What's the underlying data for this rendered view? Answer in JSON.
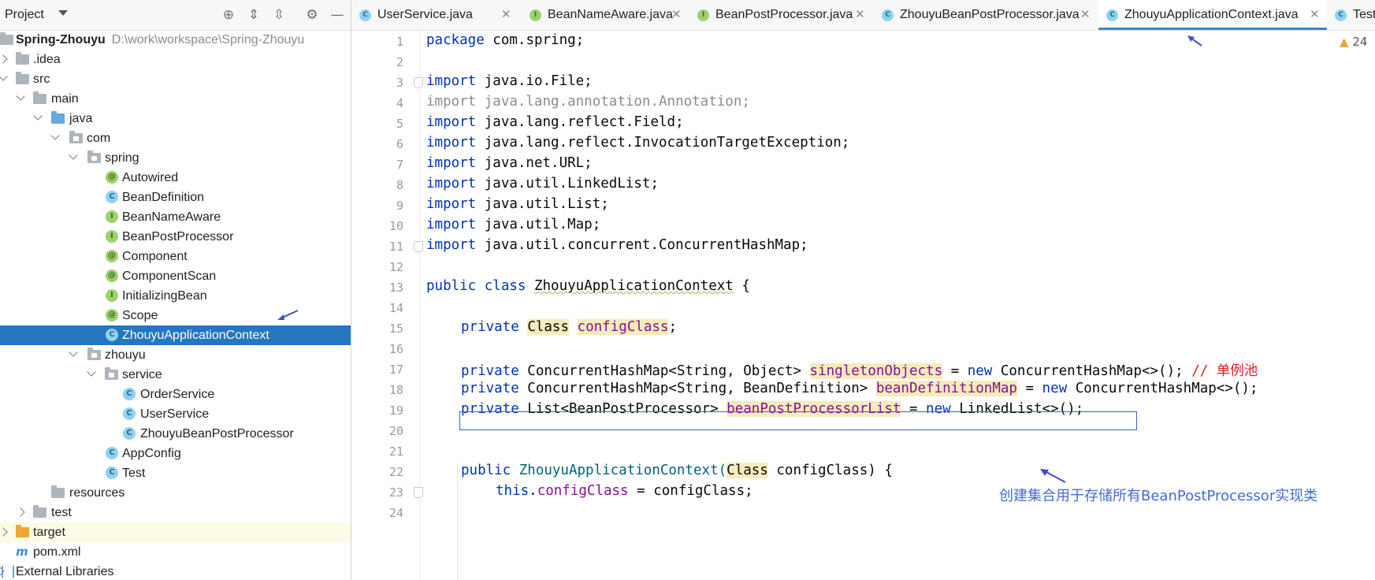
{
  "project_panel": {
    "title": "Project",
    "tree": [
      {
        "label": "Spring-Zhouyu",
        "path": "D:\\work\\workspace\\Spring-Zhouyu",
        "kind": "module"
      },
      {
        "label": ".idea",
        "kind": "folder"
      },
      {
        "label": "src",
        "kind": "folder"
      },
      {
        "label": "main",
        "kind": "folder"
      },
      {
        "label": "java",
        "kind": "source-folder"
      },
      {
        "label": "com",
        "kind": "package"
      },
      {
        "label": "spring",
        "kind": "package"
      },
      {
        "label": "Autowired",
        "kind": "annotation"
      },
      {
        "label": "BeanDefinition",
        "kind": "class"
      },
      {
        "label": "BeanNameAware",
        "kind": "interface"
      },
      {
        "label": "BeanPostProcessor",
        "kind": "interface"
      },
      {
        "label": "Component",
        "kind": "annotation"
      },
      {
        "label": "ComponentScan",
        "kind": "annotation"
      },
      {
        "label": "InitializingBean",
        "kind": "interface"
      },
      {
        "label": "Scope",
        "kind": "annotation"
      },
      {
        "label": "ZhouyuApplicationContext",
        "kind": "class"
      },
      {
        "label": "zhouyu",
        "kind": "package"
      },
      {
        "label": "service",
        "kind": "package"
      },
      {
        "label": "OrderService",
        "kind": "class"
      },
      {
        "label": "UserService",
        "kind": "class"
      },
      {
        "label": "ZhouyuBeanPostProcessor",
        "kind": "class"
      },
      {
        "label": "AppConfig",
        "kind": "class"
      },
      {
        "label": "Test",
        "kind": "class"
      },
      {
        "label": "resources",
        "kind": "folder"
      },
      {
        "label": "test",
        "kind": "folder"
      },
      {
        "label": "target",
        "kind": "excluded-folder"
      },
      {
        "label": "pom.xml",
        "kind": "maven"
      },
      {
        "label": "External Libraries",
        "kind": "libraries"
      }
    ]
  },
  "tabs": [
    {
      "label": "UserService.java",
      "icon": "class"
    },
    {
      "label": "BeanNameAware.java",
      "icon": "interface"
    },
    {
      "label": "BeanPostProcessor.java",
      "icon": "interface"
    },
    {
      "label": "ZhouyuBeanPostProcessor.java",
      "icon": "class"
    },
    {
      "label": "ZhouyuApplicationContext.java",
      "icon": "class",
      "active": true
    },
    {
      "label": "Test.jav",
      "icon": "class"
    }
  ],
  "editor": {
    "warning_count": "24",
    "line_numbers": [
      "1",
      "2",
      "3",
      "4",
      "5",
      "6",
      "7",
      "8",
      "9",
      "10",
      "11",
      "12",
      "13",
      "14",
      "15",
      "16",
      "17",
      "18",
      "19",
      "20",
      "21",
      "22",
      "23",
      "24"
    ],
    "code": {
      "l1": {
        "kw": "package",
        "rest": " com.spring;"
      },
      "l3": {
        "kw": "import",
        "rest": " java.io.File;"
      },
      "l4": {
        "text": "import java.lang.annotation.Annotation;"
      },
      "l5": {
        "kw": "import",
        "rest": " java.lang.reflect.Field;"
      },
      "l6": {
        "kw": "import",
        "rest": " java.lang.reflect.InvocationTargetException;"
      },
      "l7": {
        "kw": "import",
        "rest": " java.net.URL;"
      },
      "l8": {
        "kw": "import",
        "rest": " java.util.LinkedList;"
      },
      "l9": {
        "kw": "import",
        "rest": " java.util.List;"
      },
      "l10": {
        "kw": "import",
        "rest": " java.util.Map;"
      },
      "l11": {
        "kw": "import",
        "rest": " java.util.concurrent.ConcurrentHashMap;"
      },
      "l13": {
        "kw": "public class",
        "name": "ZhouyuApplicationContext",
        "rest": " {"
      },
      "l15": {
        "kw": "private",
        "type": "Class",
        "field": "configClass",
        "rest": ";"
      },
      "l17": {
        "kw": "private",
        "type": " ConcurrentHashMap<String, Object> ",
        "field": "singletonObjects",
        "mid": " = ",
        "kw2": "new",
        "rest": " ConcurrentHashMap<>(); ",
        "comment": "// 单例池"
      },
      "l18": {
        "kw": "private",
        "type": " ConcurrentHashMap<String, BeanDefinition> ",
        "field": "beanDefinitionMap",
        "mid": " = ",
        "kw2": "new",
        "rest": " ConcurrentHashMap<>();"
      },
      "l19": {
        "kw": "private",
        "type": " List<BeanPostProcessor> ",
        "field": "beanPostProcessorList",
        "mid": " = ",
        "kw2": "new",
        "rest": " LinkedList<>();"
      },
      "l22": {
        "kw": "public",
        "name": " ZhouyuApplicationContext(",
        "type": "Class",
        "rest": " configClass) {"
      },
      "l23": {
        "kw": "this",
        "dot": ".",
        "field": "configClass",
        "rest": " = configClass;"
      }
    },
    "annotation": "创建集合用于存储所有BeanPostProcessor实现类"
  }
}
